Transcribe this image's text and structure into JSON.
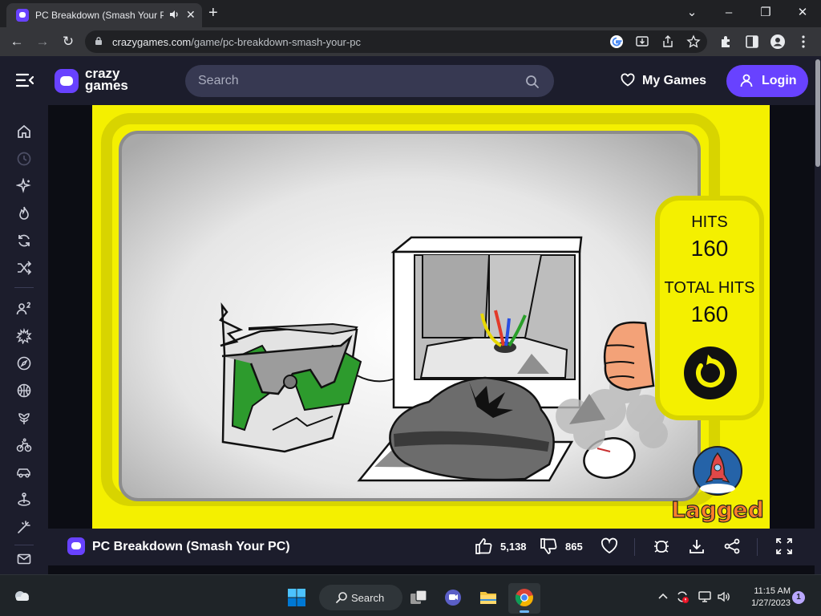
{
  "browser": {
    "tab_title": "PC Breakdown (Smash Your PC)",
    "new_tab_icon": "plus-icon",
    "url_domain": "crazygames.com",
    "url_path": "/game/pc-breakdown-smash-your-pc"
  },
  "site": {
    "logo_line1": "crazy",
    "logo_line2": "games",
    "search_placeholder": "Search",
    "my_games_label": "My Games",
    "login_label": "Login",
    "accent_color": "#6842ff"
  },
  "game": {
    "hits_label": "HITS",
    "hits_value": "160",
    "total_hits_label": "TOTAL HITS",
    "total_hits_value": "160",
    "publisher_logo": "Lagged",
    "background_color": "#f4f000"
  },
  "infobar": {
    "title": "PC Breakdown (Smash Your PC)",
    "likes": "5,138",
    "dislikes": "865"
  },
  "taskbar": {
    "search_label": "Search",
    "time": "11:15 AM",
    "date": "1/27/2023",
    "notification_count": "1"
  }
}
